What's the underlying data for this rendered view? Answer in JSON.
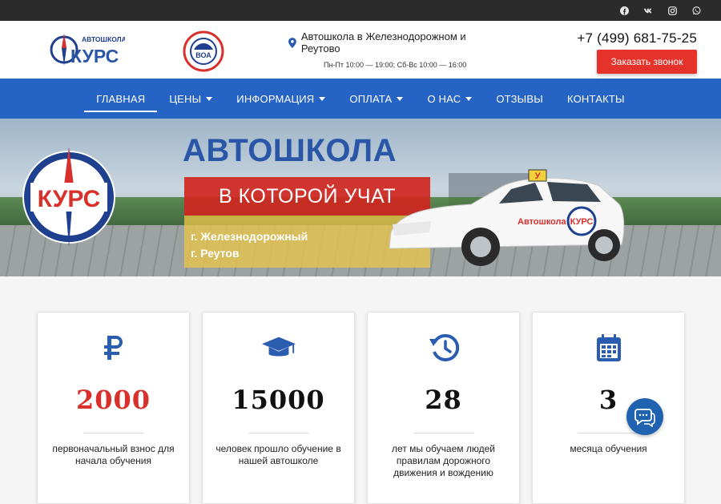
{
  "topbar": {
    "social": [
      "facebook-icon",
      "vk-icon",
      "instagram-icon",
      "whatsapp-icon"
    ]
  },
  "header": {
    "logo_small_text": "АВТОШКОЛА",
    "logo_text": "КУРС",
    "voa_text": "ВОА",
    "address": "Автошкола в Железнодорожном и Реутово",
    "hours": "Пн-Пт 10:00 — 19:00; Сб-Вс 10:00 — 16:00",
    "phone": "+7 (499) 681-75-25",
    "callback_button": "Заказать звонок"
  },
  "nav": {
    "items": [
      {
        "label": "ГЛАВНАЯ",
        "dropdown": false,
        "active": true
      },
      {
        "label": "ЦЕНЫ",
        "dropdown": true
      },
      {
        "label": "ИНФОРМАЦИЯ",
        "dropdown": true
      },
      {
        "label": "ОПЛАТА",
        "dropdown": true
      },
      {
        "label": "О НАС",
        "dropdown": true
      },
      {
        "label": "ОТЗЫВЫ",
        "dropdown": false
      },
      {
        "label": "КОНТАКТЫ",
        "dropdown": false
      }
    ]
  },
  "hero": {
    "title": "АВТОШКОЛА",
    "subtitle": "В КОТОРОЙ УЧАТ",
    "city1": "г. Железнодорожный",
    "city2": "г. Реутов",
    "car_text": "Автошкола",
    "car_logo": "КУРС",
    "sign": "У",
    "logo_text": "КУРС"
  },
  "stats": [
    {
      "icon": "ruble-icon",
      "value": "2000",
      "desc": "первоначальный взнос для начала обучения",
      "color": "#d9302c"
    },
    {
      "icon": "graduation-cap-icon",
      "value": "15000",
      "desc": "человек прошло обучение в нашей автошколе",
      "color": "#111111"
    },
    {
      "icon": "history-icon",
      "value": "28",
      "desc": "лет мы обучаем людей правилам дорожного движения и вождению",
      "color": "#111111"
    },
    {
      "icon": "calendar-icon",
      "value": "3",
      "desc": "месяца обучения",
      "color": "#111111"
    }
  ],
  "colors": {
    "brand_blue": "#2563c4",
    "accent_red": "#e5322a",
    "icon_blue": "#2a5db0"
  }
}
